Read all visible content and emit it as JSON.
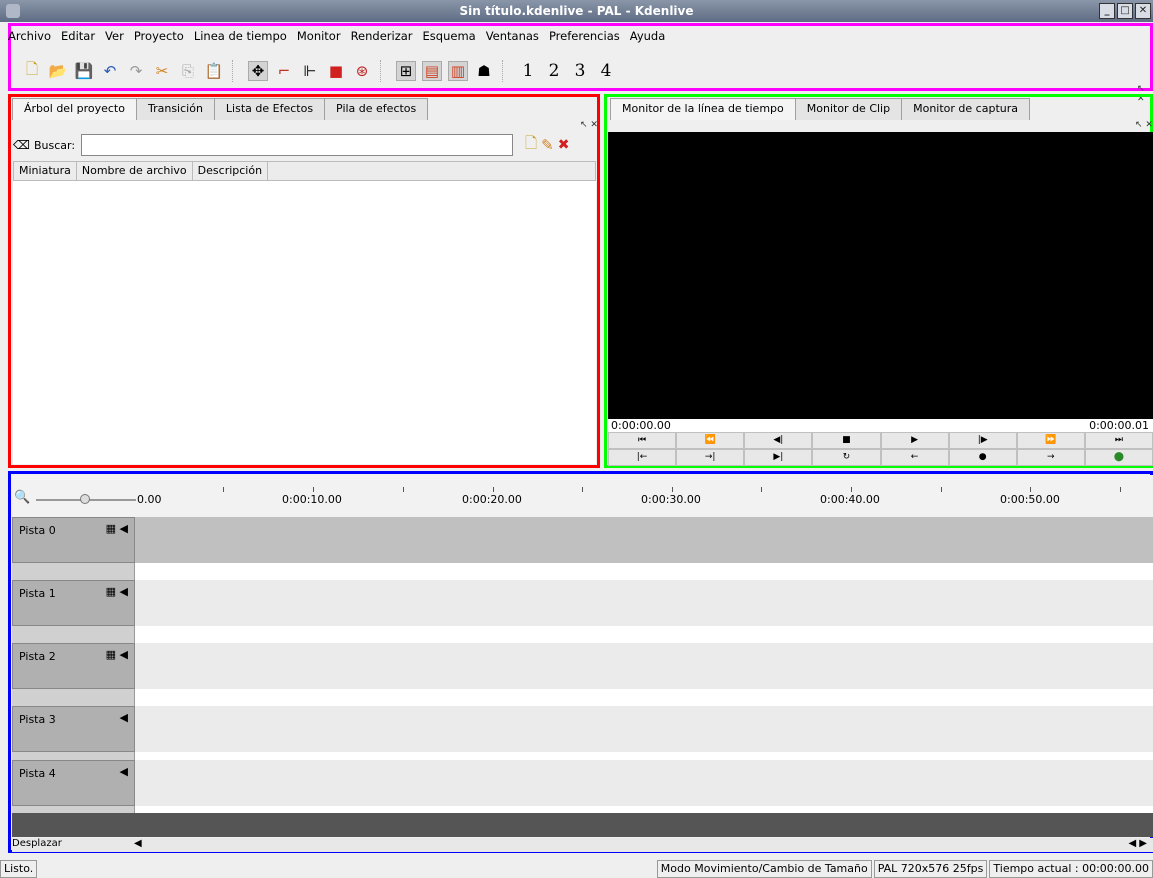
{
  "window": {
    "title": "Sin título.kdenlive - PAL - Kdenlive",
    "buttons": [
      "minimize-icon",
      "maximize-icon",
      "close-icon"
    ]
  },
  "menubar": [
    "Archivo",
    "Editar",
    "Ver",
    "Proyecto",
    "Linea de tiempo",
    "Monitor",
    "Renderizar",
    "Esquema",
    "Ventanas",
    "Preferencias",
    "Ayuda"
  ],
  "toolbar": {
    "layouts": [
      "1",
      "2",
      "3",
      "4"
    ]
  },
  "project_panel": {
    "tabs": [
      "Árbol del proyecto",
      "Transición",
      "Lista de Efectos",
      "Pila de efectos"
    ],
    "search_label": "Buscar:",
    "search_value": "",
    "columns": [
      "Miniatura",
      "Nombre de archivo",
      "Descripción"
    ]
  },
  "monitor_panel": {
    "tabs": [
      "Monitor de la línea de tiempo",
      "Monitor de Clip",
      "Monitor de captura"
    ],
    "time_start": "0:00:00.00",
    "time_end": "0:00:00.01"
  },
  "timeline": {
    "scale_labels": [
      "0.00",
      "0:00:10.00",
      "0:00:20.00",
      "0:00:30.00",
      "0:00:40.00",
      "0:00:50.00"
    ],
    "tracks": [
      "Pista 0",
      "Pista 1",
      "Pista 2",
      "Pista 3",
      "Pista 4"
    ],
    "scroll_label": "Desplazar"
  },
  "status": {
    "message": "Listo.",
    "mode": "Modo Movimiento/Cambio de Tamaño",
    "format": "PAL 720x576 25fps",
    "current_time": "Tiempo actual : 00:00:00.00"
  },
  "colors": {
    "frame_menu": "#ff00ff",
    "frame_project": "#ff0000",
    "frame_monitor": "#00ff00",
    "frame_timeline": "#0000ff"
  }
}
